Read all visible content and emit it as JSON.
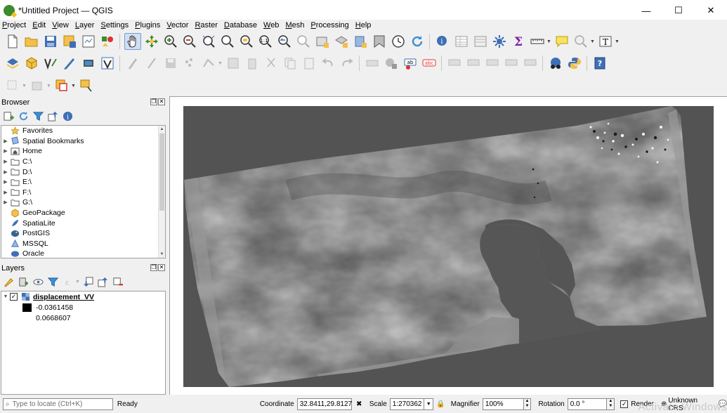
{
  "window": {
    "title": "*Untitled Project — QGIS",
    "minimize": "—",
    "maximize": "☐",
    "close": "✕"
  },
  "menu": [
    "Project",
    "Edit",
    "View",
    "Layer",
    "Settings",
    "Plugins",
    "Vector",
    "Raster",
    "Database",
    "Web",
    "Mesh",
    "Processing",
    "Help"
  ],
  "browser": {
    "title": "Browser",
    "items": [
      {
        "label": "Favorites",
        "icon": "star-icon",
        "expandable": false
      },
      {
        "label": "Spatial Bookmarks",
        "icon": "bookmark-icon",
        "expandable": true
      },
      {
        "label": "Home",
        "icon": "home-folder-icon",
        "expandable": true
      },
      {
        "label": "C:\\",
        "icon": "folder-icon",
        "expandable": true
      },
      {
        "label": "D:\\",
        "icon": "folder-icon",
        "expandable": true
      },
      {
        "label": "E:\\",
        "icon": "folder-icon",
        "expandable": true
      },
      {
        "label": "F:\\",
        "icon": "folder-icon",
        "expandable": true
      },
      {
        "label": "G:\\",
        "icon": "folder-icon",
        "expandable": true
      },
      {
        "label": "GeoPackage",
        "icon": "geopackage-icon",
        "expandable": false
      },
      {
        "label": "SpatiaLite",
        "icon": "spatialite-icon",
        "expandable": false
      },
      {
        "label": "PostGIS",
        "icon": "postgis-icon",
        "expandable": false
      },
      {
        "label": "MSSQL",
        "icon": "mssql-icon",
        "expandable": false
      },
      {
        "label": "Oracle",
        "icon": "oracle-icon",
        "expandable": false
      }
    ]
  },
  "layers": {
    "title": "Layers",
    "layer_name": "displacement_VV",
    "checked": true,
    "legend_min": "-0.0361458",
    "legend_max": "0.0668607"
  },
  "status": {
    "locator_placeholder": "Type to locate (Ctrl+K)",
    "ready": "Ready",
    "coordinate_label": "Coordinate",
    "coordinate_value": "32.8411,29.8127",
    "scale_label": "Scale",
    "scale_value": "1:270362",
    "magnifier_label": "Magnifier",
    "magnifier_value": "100%",
    "rotation_label": "Rotation",
    "rotation_value": "0.0 °",
    "render_label": "Render",
    "crs": "Unknown CRS",
    "watermark": "Activate Windows"
  },
  "colors": {
    "canvas_bg": "#535353",
    "raster_light": "#9a9a9a",
    "raster_dark": "#5e5e5e"
  }
}
